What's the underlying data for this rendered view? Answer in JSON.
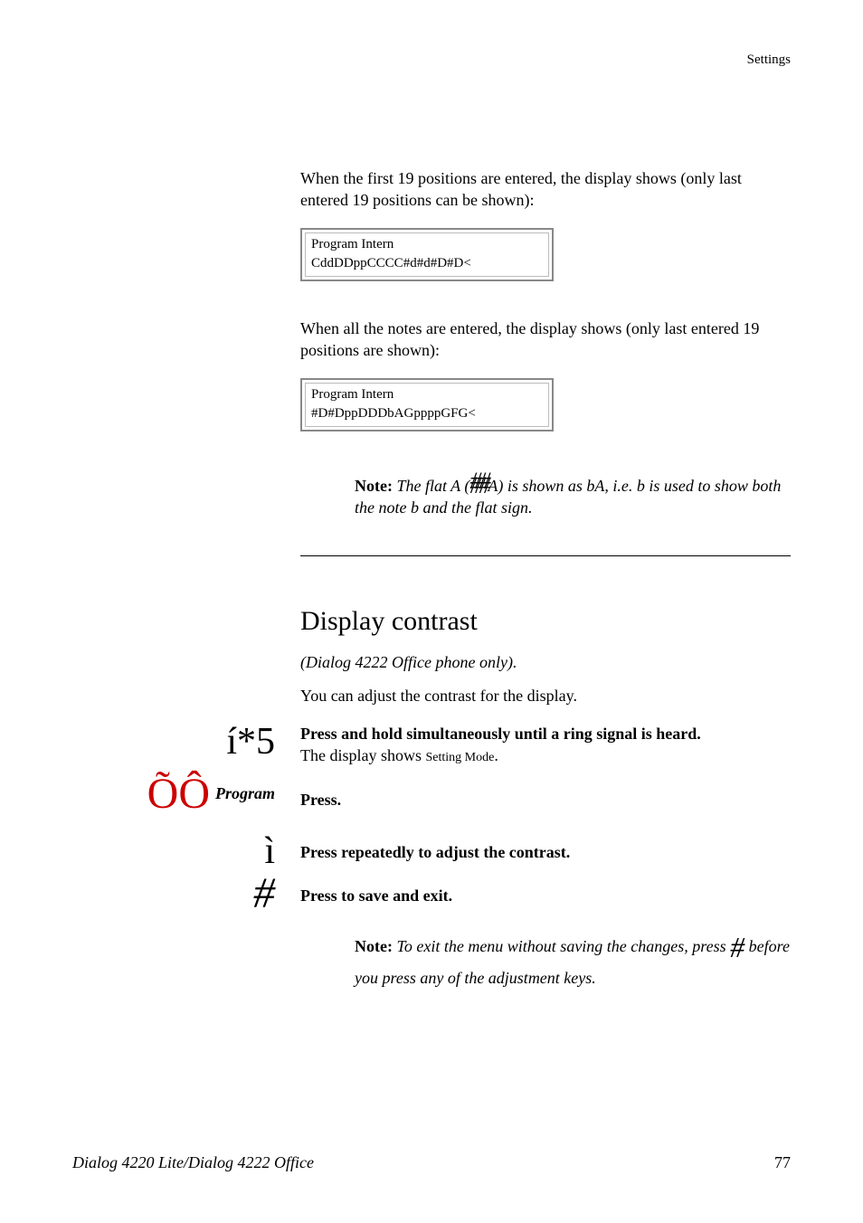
{
  "header": {
    "section": "Settings"
  },
  "intro1": "When the first 19 positions are entered, the display shows (only last entered 19 positions can be shown):",
  "display1": {
    "line1": "Program Intern",
    "line2": "CddDDppCCCC#d#d#D#D<"
  },
  "intro2": "When all the notes are entered, the display shows (only last entered 19 positions are shown):",
  "display2": {
    "line1": "Program Intern",
    "line2": "#D#DppDDDbAGppppGFG<"
  },
  "note1": {
    "label": "Note:",
    "pre": " The flat A (",
    "symbol": "##",
    "post": "A) is shown as bA, i.e. b is used to show both the note b and the flat sign."
  },
  "section": {
    "heading": "Display contrast",
    "subtitle": "(Dialog 4222 Office phone only).",
    "intro": "You can adjust the contrast for the display."
  },
  "step1": {
    "glyph": "í*5",
    "bold": "Press and hold simultaneously until a ring signal is heard.",
    "plain_pre": "The display shows ",
    "setting_mode": "Setting Mode",
    "plain_post": "."
  },
  "step2": {
    "glyph": "ÕÔ",
    "label": "Program",
    "bold": "Press."
  },
  "step3": {
    "glyph": "ì",
    "bold": "Press repeatedly to adjust the contrast."
  },
  "step4": {
    "glyph": "#",
    "bold": "Press to save and exit."
  },
  "note2": {
    "label": "Note:",
    "pre": " To exit the menu without saving the changes, press ",
    "symbol": "#",
    "post": " before you press any of the adjustment keys."
  },
  "footer": {
    "left": "Dialog 4220 Lite/Dialog 4222 Office",
    "right": "77"
  }
}
